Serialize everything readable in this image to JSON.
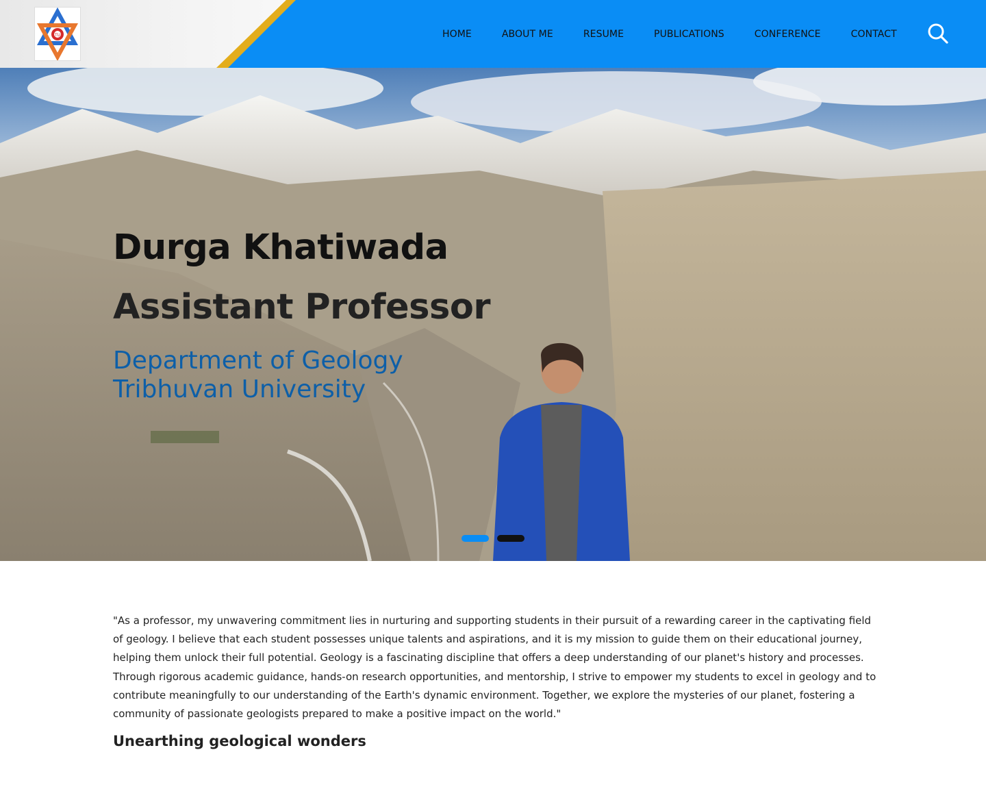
{
  "header": {
    "logo_icon": "tribhuvan-university-logo",
    "nav": [
      {
        "label": "HOME"
      },
      {
        "label": "ABOUT ME"
      },
      {
        "label": "RESUME"
      },
      {
        "label": "PUBLICATIONS"
      },
      {
        "label": "CONFERENCE"
      },
      {
        "label": "CONTACT"
      }
    ],
    "search_icon": "search-icon",
    "colors": {
      "bar": "#0a8df5",
      "stripe": "#e3ad1c"
    }
  },
  "hero": {
    "name": "Durga Khatiwada",
    "title": "Assistant Professor",
    "department": "Department of Geology",
    "university": "Tribhuvan University",
    "slider": {
      "count": 2,
      "active": 1,
      "active_color": "#0a8df5",
      "inactive_color": "#111111"
    }
  },
  "main": {
    "quote": "\"As a professor, my unwavering commitment lies in nurturing and supporting students in their pursuit of a rewarding career in the captivating field of geology. I believe that each student possesses unique talents and aspirations, and it is my mission to guide them on their educational journey, helping them unlock their full potential. Geology is a fascinating discipline that offers a deep understanding of our planet's history and processes. Through rigorous academic guidance, hands-on research opportunities, and mentorship, I strive to empower my students to excel in geology and to contribute meaningfully to our understanding of the Earth's dynamic environment. Together, we explore the mysteries of our planet, fostering a community of passionate geologists prepared to make a positive impact on the world.\"",
    "section_title": "Unearthing geological wonders"
  }
}
